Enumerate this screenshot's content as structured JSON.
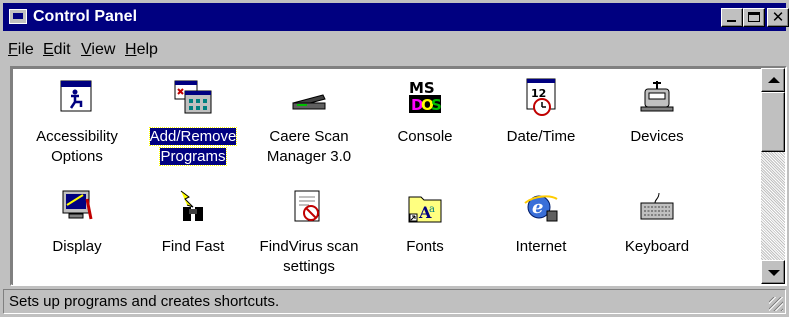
{
  "window": {
    "title": "Control Panel"
  },
  "menu": [
    {
      "hotkey": "F",
      "rest": "ile"
    },
    {
      "hotkey": "E",
      "rest": "dit"
    },
    {
      "hotkey": "V",
      "rest": "iew"
    },
    {
      "hotkey": "H",
      "rest": "elp"
    }
  ],
  "items": [
    {
      "label1": "Accessibility",
      "label2": "Options",
      "icon": "accessibility-icon"
    },
    {
      "label1": "Add/Remove",
      "label2": "Programs",
      "icon": "add-remove-programs-icon",
      "selected": true
    },
    {
      "label1": "Caere Scan",
      "label2": "Manager 3.0",
      "icon": "scanner-icon"
    },
    {
      "label1": "Console",
      "label2": "",
      "icon": "msdos-console-icon"
    },
    {
      "label1": "Date/Time",
      "label2": "",
      "icon": "calendar-clock-icon"
    },
    {
      "label1": "Devices",
      "label2": "",
      "icon": "devices-icon"
    },
    {
      "label1": "Display",
      "label2": "",
      "icon": "display-icon"
    },
    {
      "label1": "Find Fast",
      "label2": "",
      "icon": "binoculars-icon"
    },
    {
      "label1": "FindVirus scan",
      "label2": "settings",
      "icon": "findvirus-icon"
    },
    {
      "label1": "Fonts",
      "label2": "",
      "icon": "fonts-folder-icon"
    },
    {
      "label1": "Internet",
      "label2": "",
      "icon": "internet-explorer-icon"
    },
    {
      "label1": "Keyboard",
      "label2": "",
      "icon": "keyboard-icon"
    }
  ],
  "status": {
    "text": "Sets up programs and creates shortcuts."
  },
  "colors": {
    "title_bar": "#000080",
    "face": "#c0c0c0",
    "selection": "#000080"
  }
}
